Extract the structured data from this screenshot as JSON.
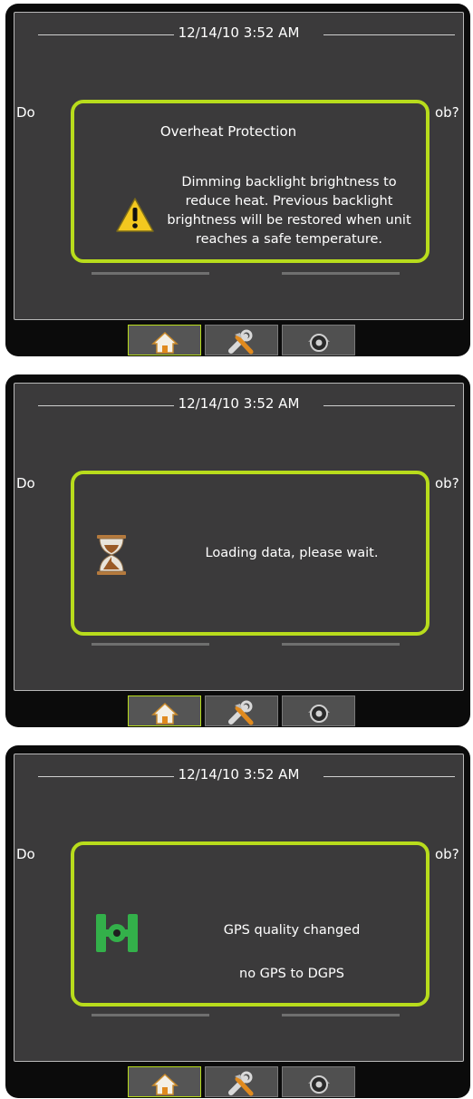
{
  "panels": [
    {
      "datetime": "12/14/10 3:52 AM",
      "bg_question_left": "Do",
      "bg_question_right": "ob?",
      "popup": {
        "title": "Overheat Protection",
        "message_lines": [
          "Dimming backlight brightness to",
          "reduce heat.  Previous backlight",
          "brightness will be restored when unit",
          "reaches a safe temperature."
        ],
        "icon": "warning-icon"
      }
    },
    {
      "datetime": "12/14/10 3:52 AM",
      "bg_question_left": "Do",
      "bg_question_right": "ob?",
      "popup": {
        "title": "",
        "message_lines": [
          "Loading data, please wait."
        ],
        "icon": "hourglass-icon"
      }
    },
    {
      "datetime": "12/14/10 3:52 AM",
      "bg_question_left": "Do",
      "bg_question_right": "ob?",
      "popup": {
        "title": "",
        "message_lines": [
          "GPS quality changed",
          "",
          "no GPS to DGPS"
        ],
        "icon": "gps-receiver-icon"
      }
    }
  ],
  "tabs": [
    {
      "icon": "home-icon",
      "active": true
    },
    {
      "icon": "tools-icon",
      "active": false
    },
    {
      "icon": "camera-icon",
      "active": false
    }
  ],
  "colors": {
    "screen_bg": "#3b3a3b",
    "bezel": "#0b0b0b",
    "popup_border": "#b8dc1c",
    "warning_yellow": "#f3c81f",
    "gps_green": "#33b04a"
  }
}
